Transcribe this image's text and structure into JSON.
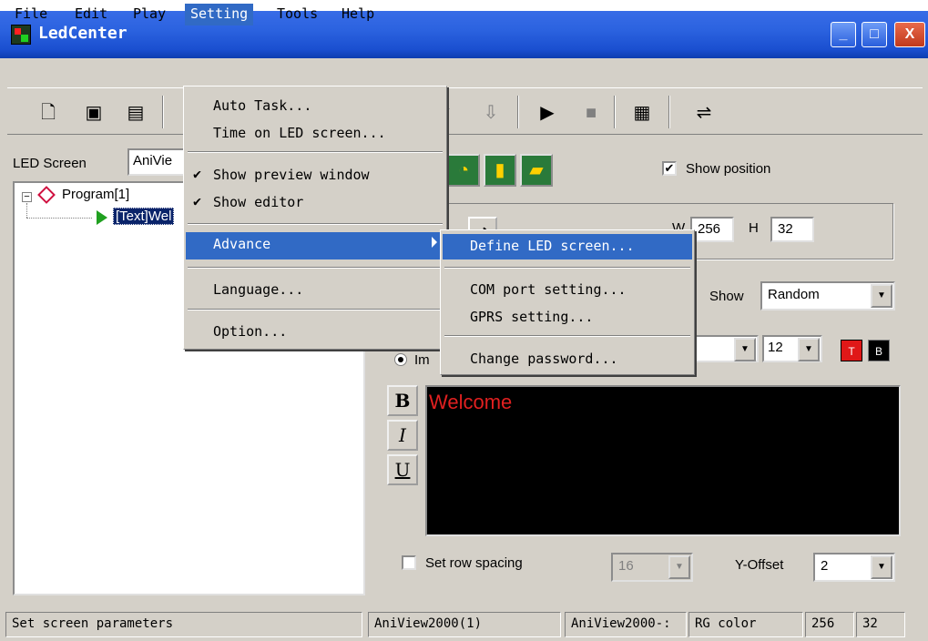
{
  "window": {
    "title": "LedCenter",
    "minimize": "_",
    "maximize": "□",
    "close": "X"
  },
  "menubar": [
    "File",
    "Edit",
    "Play",
    "Setting",
    "Tools",
    "Help"
  ],
  "setting_menu": {
    "items": [
      "Auto Task...",
      "Time on LED screen...",
      "Show preview window",
      "Show editor",
      "Advance",
      "Language...",
      "Option..."
    ],
    "checked": [
      "Show preview window",
      "Show editor"
    ],
    "highlighted": "Advance"
  },
  "advance_submenu": {
    "items": [
      "Define LED screen...",
      "COM port setting...",
      "GPRS setting...",
      "Change password..."
    ],
    "highlighted": "Define LED screen..."
  },
  "toolbar_icons": [
    "new-icon",
    "open-icon",
    "save-icon",
    "up-icon",
    "down-icon",
    "play-icon",
    "stop-icon",
    "calculator-icon",
    "send-icon"
  ],
  "left_panel": {
    "led_screen_label": "LED Screen",
    "led_screen_value": "AniVie",
    "tree": {
      "program": "Program[1]",
      "text_item": "[Text]Wel"
    }
  },
  "right_panel": {
    "show_position_label": "Show position",
    "show_position_checked": true,
    "width_label": "W",
    "width_value": "256",
    "height_label": "H",
    "height_value": "32",
    "show_label": "Show",
    "show_value": "Random",
    "font_size": "12",
    "color_t": "T",
    "color_b": "B",
    "radio_label": "Im",
    "bold": "B",
    "italic": "I",
    "underline": "U",
    "editor_text": "Welcome",
    "row_spacing_label": "Set row spacing",
    "row_spacing_value": "16",
    "yoffset_label": "Y-Offset",
    "yoffset_value": "2",
    "colors": {
      "editor_bg": "#000000",
      "editor_text": "#e02020"
    }
  },
  "statusbar": {
    "message": "Set screen parameters",
    "screen1": "AniView2000(1)",
    "screen2": "AniView2000-:",
    "color_mode": "RG color",
    "width": "256",
    "height": "32"
  }
}
